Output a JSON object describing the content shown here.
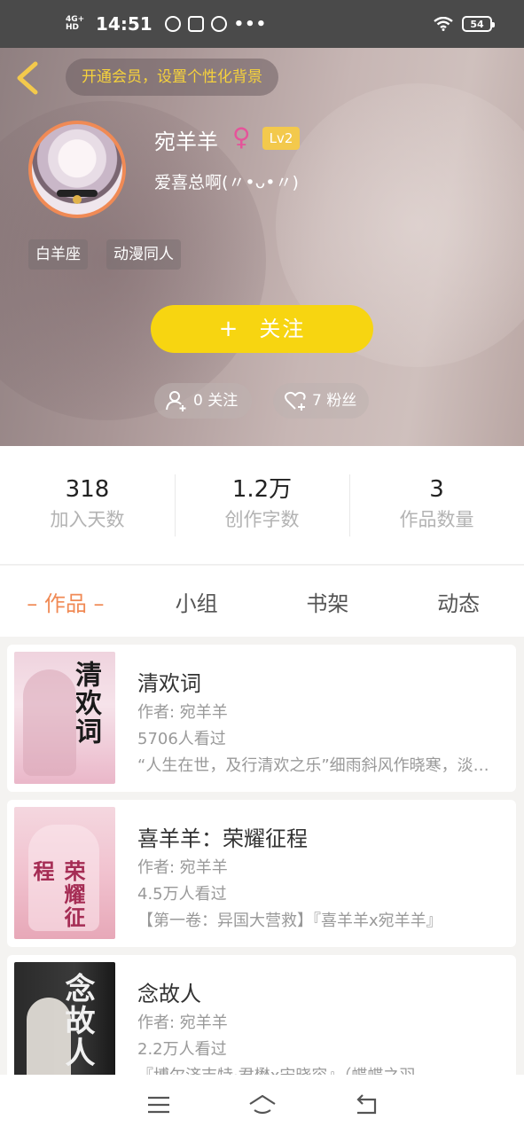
{
  "status_bar": {
    "network": "4G+ HD",
    "time": "14:51",
    "more": "•••",
    "battery": "54"
  },
  "header": {
    "vip_banner": "开通会员，设置个性化背景",
    "username": "宛羊羊",
    "gender_symbol": "♀",
    "level": "Lv2",
    "signature": "爱喜总啊(〃•ᴗ•〃)",
    "tags": [
      "白羊座",
      "动漫同人"
    ],
    "follow_button": {
      "plus": "+",
      "label": "关注"
    },
    "following": "0 关注",
    "fans": "7 粉丝"
  },
  "stats": [
    {
      "value": "318",
      "label": "加入天数"
    },
    {
      "value": "1.2万",
      "label": "创作字数"
    },
    {
      "value": "3",
      "label": "作品数量"
    }
  ],
  "tabs": [
    "– 作品 –",
    "小组",
    "书架",
    "动态"
  ],
  "books": [
    {
      "cover_text": "清欢词",
      "title": "清欢词",
      "author": "作者: 宛羊羊",
      "views": "5706人看过",
      "desc": "“人生在世，及行清欢之乐”细雨斜风作晓寒，淡烟疏柳媚晴滩"
    },
    {
      "cover_text": "荣耀征程",
      "title": "喜羊羊：荣耀征程",
      "author": "作者: 宛羊羊",
      "views": "4.5万人看过",
      "desc": "【第一卷：异国大营救】『喜羊羊x宛羊羊』"
    },
    {
      "cover_text": "念故人",
      "title": "念故人",
      "author": "作者: 宛羊羊",
      "views": "2.2万人看过",
      "desc": "『博尔济吉特·君懋x宋晓容』（蝶蝶之羽"
    }
  ],
  "colors": {
    "accent_orange": "#f08a55",
    "follow_yellow": "#f7d511",
    "vip_text": "#f6d23c",
    "gender_pink": "#e5549a"
  }
}
